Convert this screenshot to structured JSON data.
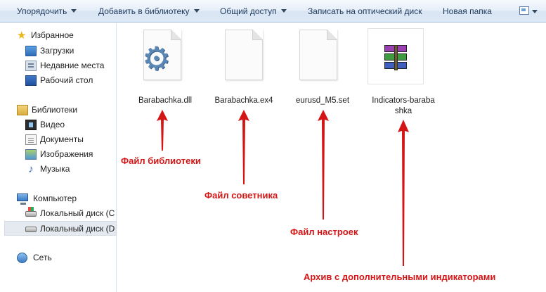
{
  "toolbar": {
    "organize": "Упорядочить",
    "add_to_library": "Добавить в библиотеку",
    "share": "Общий доступ",
    "burn": "Записать на оптический диск",
    "new_folder": "Новая папка"
  },
  "nav": {
    "favorites": "Избранное",
    "downloads": "Загрузки",
    "recent": "Недавние места",
    "desktop": "Рабочий стол",
    "libraries": "Библиотеки",
    "video": "Видео",
    "documents": "Документы",
    "images": "Изображения",
    "music": "Музыка",
    "computer": "Компьютер",
    "disk_c": "Локальный диск (C",
    "disk_d": "Локальный диск (D",
    "network": "Сеть"
  },
  "files": {
    "dll": "Barabachka.dll",
    "ex4": "Barabachka.ex4",
    "set": "eurusd_M5.set",
    "archive_line1": "Indicators-baraba",
    "archive_line2": "shka"
  },
  "annotations": {
    "library_file": "Файл библиотеки",
    "advisor_file": "Файл советника",
    "settings_file": "Файл настроек",
    "archive": "Архив с дополнительными индикаторами"
  },
  "colors": {
    "annotation": "#d41515",
    "toolbar_text": "#1e395b",
    "selected_bg": "#e5eaf0"
  }
}
